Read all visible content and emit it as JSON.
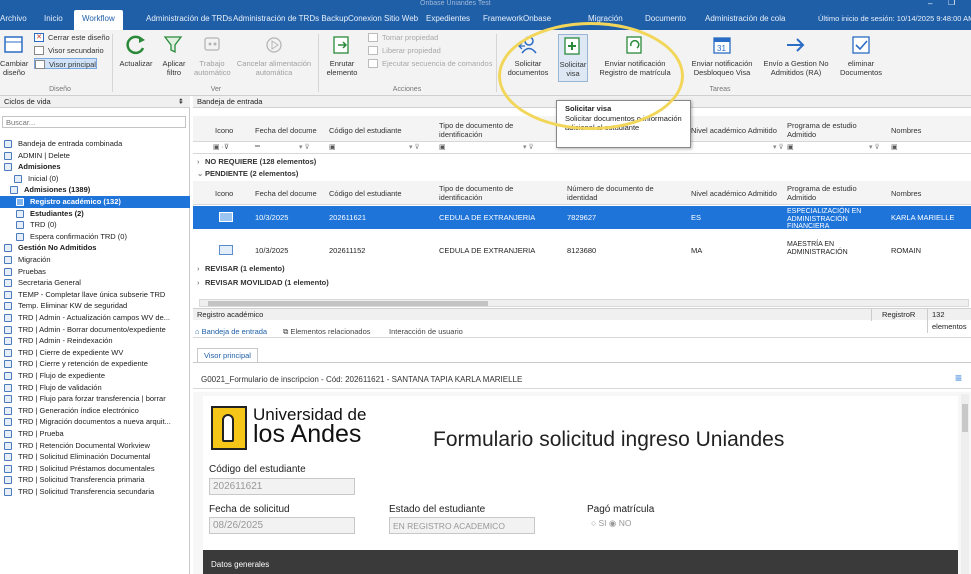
{
  "window": {
    "title": "Onbase Uniandes Test",
    "accent": "#1f5fa8"
  },
  "tabs": [
    {
      "label": "Archivo"
    },
    {
      "label": "Inicio"
    },
    {
      "label": "Workflow"
    },
    {
      "label": "Administración de TRDs"
    },
    {
      "label": "Administración de TRDs Backup"
    },
    {
      "label": "Conexion Sitio Web"
    },
    {
      "label": "Expedientes"
    },
    {
      "label": "FrameworkOnbase"
    },
    {
      "label": "Migración"
    },
    {
      "label": "Documento"
    },
    {
      "label": "Administración de cola"
    }
  ],
  "last_login": "Último inicio de sesión: 10/14/2025 9:48:00 AM",
  "ribbon": {
    "diseno": {
      "cerrar": "Cerrar este diseño",
      "visor_sec": "Visor secundario",
      "visor_pri": "Visor principal",
      "cambiar": "Cambiar diseño",
      "group": "Diseño"
    },
    "ver": {
      "actualizar": "Actualizar",
      "aplicar_filtro": "Aplicar filtro",
      "trabajo_auto": "Trabajo automático",
      "cancelar": "Cancelar alimentación automática",
      "group": "Ver"
    },
    "acciones": {
      "enrutar": "Enrutar elemento",
      "tomar": "Tomar propiedad",
      "liberar": "Liberar propiedad",
      "ejecutar": "Ejecutar secuencia de comandos",
      "group": "Acciones"
    },
    "tareas": {
      "solicitar_docs": "Solicitar documentos",
      "solicitar_visa": "Solicitar visa",
      "notif_registro": "Enviar notificación Registro de matrícula",
      "notif_desbloq": "Enviar notificación Desbloqueo Visa",
      "envio_gestion": "Envío a Gestion No Admitidos (RA)",
      "eliminar": "eliminar Documentos",
      "group": "Tareas"
    }
  },
  "tooltip": {
    "title": "Solicitar visa",
    "text": "Solicitar documentos o información adicional al estudiante"
  },
  "left_panel": {
    "header": "Ciclos de vida",
    "search_placeholder": "Buscar...",
    "items": [
      {
        "label": "Bandeja de entrada combinada",
        "bold": false,
        "sel": false
      },
      {
        "label": "ADMIN | Delete",
        "bold": false,
        "sel": false
      },
      {
        "label": "Admisiones",
        "bold": true,
        "sel": false
      },
      {
        "label": "Inicial (0)",
        "bold": false,
        "sel": false
      },
      {
        "label": "Admisiones (1389)",
        "bold": true,
        "sel": false
      },
      {
        "label": "Registro académico (132)",
        "bold": true,
        "sel": true
      },
      {
        "label": "Estudiantes (2)",
        "bold": true,
        "sel": false
      },
      {
        "label": "TRD (0)",
        "bold": false,
        "sel": false
      },
      {
        "label": "Espera confirmación TRD (0)",
        "bold": false,
        "sel": false
      },
      {
        "label": "Gestión No Admitidos",
        "bold": true,
        "sel": false
      },
      {
        "label": "Migración",
        "bold": false,
        "sel": false
      },
      {
        "label": "Pruebas",
        "bold": false,
        "sel": false
      },
      {
        "label": "Secretaria General",
        "bold": false,
        "sel": false
      },
      {
        "label": "TEMP - Completar llave única subserie TRD",
        "bold": false,
        "sel": false
      },
      {
        "label": "Temp. Eliminar KW de seguridad",
        "bold": false,
        "sel": false
      },
      {
        "label": "TRD | Admin - Actualización campos WV de...",
        "bold": false,
        "sel": false
      },
      {
        "label": "TRD | Admin - Borrar documento/expediente",
        "bold": false,
        "sel": false
      },
      {
        "label": "TRD | Admin - Reindexación",
        "bold": false,
        "sel": false
      },
      {
        "label": "TRD | Cierre de expediente WV",
        "bold": false,
        "sel": false
      },
      {
        "label": "TRD | Cierre y retención de expediente",
        "bold": false,
        "sel": false
      },
      {
        "label": "TRD | Flujo de expediente",
        "bold": false,
        "sel": false
      },
      {
        "label": "TRD | Flujo de validación",
        "bold": false,
        "sel": false
      },
      {
        "label": "TRD | Flujo para forzar transferencia | borrar",
        "bold": false,
        "sel": false
      },
      {
        "label": "TRD | Generación índice electrónico",
        "bold": false,
        "sel": false
      },
      {
        "label": "TRD | Migración documentos a nueva arquit...",
        "bold": false,
        "sel": false
      },
      {
        "label": "TRD | Prueba",
        "bold": false,
        "sel": false
      },
      {
        "label": "TRD | Retención Documental Workview",
        "bold": false,
        "sel": false
      },
      {
        "label": "TRD | Solicitud Eliminación Documental",
        "bold": false,
        "sel": false
      },
      {
        "label": "TRD | Solicitud Préstamos documentales",
        "bold": false,
        "sel": false
      },
      {
        "label": "TRD | Solicitud Transferencia primaria",
        "bold": false,
        "sel": false
      },
      {
        "label": "TRD | Solicitud Transferencia secundaria",
        "bold": false,
        "sel": false
      }
    ]
  },
  "inbox": {
    "title": "Bandeja de entrada",
    "columns": [
      "Icono",
      "Fecha del docume",
      "Código del estudiante",
      "Tipo de documento de identificación",
      "Número de documento de identidad",
      "Nivel académico Admitido",
      "Programa de estudio Admitido",
      "Nombres"
    ],
    "groups": {
      "no_requiere": "NO REQUIERE (128 elementos)",
      "pendiente": "PENDIENTE (2 elementos)",
      "revisar": "REVISAR (1 elemento)",
      "revisar_mov": "REVISAR MOVILIDAD (1 elemento)"
    },
    "rows": [
      {
        "fecha": "10/3/2025",
        "codigo": "202611621",
        "tipo": "CEDULA DE EXTRANJERIA",
        "numero": "7829627",
        "nivel": "ES",
        "programa": "ESPECIALIZACIÓN EN ADMINISTRACIÓN FINANCIERA",
        "nombres": "KARLA MARIELLE"
      },
      {
        "fecha": "10/3/2025",
        "codigo": "202611152",
        "tipo": "CEDULA DE EXTRANJERIA",
        "numero": "8123680",
        "nivel": "MA",
        "programa": "MAESTRÍA EN ADMINISTRACIÓN",
        "nombres": "ROMAIN"
      }
    ],
    "status_left": "Registro académico",
    "status_right": "RegistroR",
    "status_count": "132 elementos"
  },
  "lower": {
    "tabs": [
      "Bandeja de entrada",
      "Elementos relacionados",
      "Interacción de usuario"
    ],
    "viewer_tab": "Visor principal",
    "doc_title": "G0021_Formulario de inscripcion - Cód: 202611621 - SANTANA TAPIA KARLA MARIELLE",
    "form": {
      "logo_line1": "Universidad de",
      "logo_line2": "los Andes",
      "heading": "Formulario solicitud ingreso Uniandes",
      "codigo_label": "Código del estudiante",
      "codigo_val": "202611621",
      "fecha_label": "Fecha de solicitud",
      "fecha_val": "08/26/2025",
      "estado_label": "Estado del estudiante",
      "estado_val": "EN REGISTRO ACADEMICO",
      "pago_label": "Pagó matrícula",
      "pago_si": "SI",
      "pago_no": "NO",
      "section": "Datos generales"
    }
  }
}
